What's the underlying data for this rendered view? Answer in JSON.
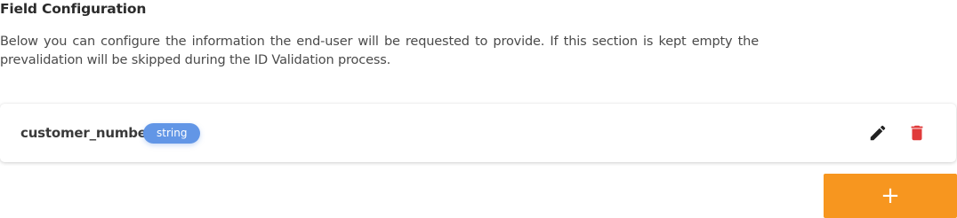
{
  "section": {
    "title": "Field Configuration",
    "description": "Below you can configure the information the end-user will be requested to provide. If this section is kept empty the prevalidation will be skipped during the ID Validation process."
  },
  "fields": [
    {
      "name": "customer_number",
      "type": "string",
      "edit_icon": "pencil-icon",
      "delete_icon": "trash-icon"
    }
  ],
  "add_button": {
    "label": "+"
  },
  "colors": {
    "badge": "#6296e6",
    "delete": "#e03a3a",
    "edit": "#222222",
    "add_button": "#f7961f"
  }
}
